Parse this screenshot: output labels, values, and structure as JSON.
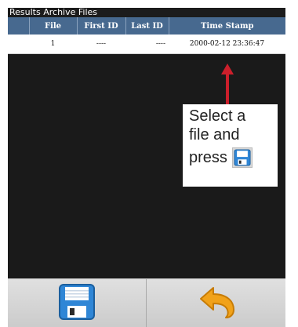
{
  "window": {
    "title": "Results Archive Files"
  },
  "table": {
    "columns": [
      "File",
      "First ID",
      "Last ID",
      "Time Stamp"
    ],
    "rows": [
      {
        "file": "1",
        "first_id": "----",
        "last_id": "----",
        "time_stamp": "2000-02-12 23:36:47"
      }
    ]
  },
  "annotation": {
    "line1": "Select a",
    "line2": "file and",
    "line3": "press",
    "icon": "save-icon"
  },
  "toolbar": {
    "save_icon": "save-icon",
    "back_icon": "undo-arrow-icon"
  },
  "colors": {
    "header": "#47698f",
    "arrow": "#cc1f2b",
    "save_icon": "#2f86d6",
    "back_icon": "#f1a21a"
  }
}
